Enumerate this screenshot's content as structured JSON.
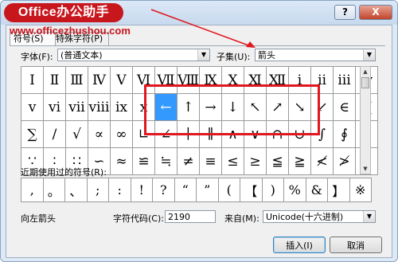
{
  "title": {
    "logo": "Office办公助手",
    "watermark": "www.officezhushou.com"
  },
  "titlebar_buttons": {
    "help": "?",
    "close": "X"
  },
  "tabs": [
    {
      "label": "符号(S)",
      "active": true
    },
    {
      "label": "特殊字符(P)",
      "active": false
    }
  ],
  "font": {
    "label": "字体(F):",
    "value": "(普通文本)"
  },
  "subset": {
    "label": "子集(U):",
    "value": "箭头"
  },
  "grid": [
    [
      "Ⅰ",
      "Ⅱ",
      "Ⅲ",
      "Ⅳ",
      "Ⅴ",
      "Ⅵ",
      "Ⅶ",
      "Ⅷ",
      "Ⅸ",
      "Ⅹ",
      "Ⅺ",
      "Ⅻ",
      "ⅰ",
      "ⅱ",
      "ⅲ",
      "ⅳ"
    ],
    [
      "ⅴ",
      "ⅵ",
      "ⅶ",
      "ⅷ",
      "ⅸ",
      "ⅹ",
      "←",
      "↑",
      "→",
      "↓",
      "↖",
      "↗",
      "↘",
      "↙",
      "∈",
      "∏"
    ],
    [
      "∑",
      "/",
      "√",
      "∝",
      "∞",
      "∟",
      "∠",
      "∣",
      "∥",
      "∧",
      "∨",
      "∩",
      "∪",
      "∫",
      "∮",
      "∴"
    ],
    [
      "∵",
      "∶",
      "∷",
      "∽",
      "≈",
      "≌",
      "≒",
      "≠",
      "≡",
      "≤",
      "≥",
      "≦",
      "≧",
      "≮",
      "≯",
      "⊕"
    ]
  ],
  "selected_cell": {
    "row": 1,
    "col": 6
  },
  "recent": {
    "label": "近期使用过的符号(R):",
    "symbols": [
      ",",
      "。",
      "、",
      ";",
      ":",
      "!",
      "?",
      "“",
      "”",
      "(",
      "【",
      ")",
      "%",
      "&",
      "】",
      "※"
    ]
  },
  "description": "向左箭头",
  "char_code": {
    "label": "字符代码(C):",
    "value": "2190"
  },
  "from": {
    "label": "来自(M):",
    "value": "Unicode(十六进制)"
  },
  "buttons": {
    "insert": "插入(I)",
    "cancel": "取消"
  },
  "colors": {
    "accent_red": "#e0171e",
    "selection_blue": "#3399ff",
    "logo_red": "#c8161d"
  }
}
